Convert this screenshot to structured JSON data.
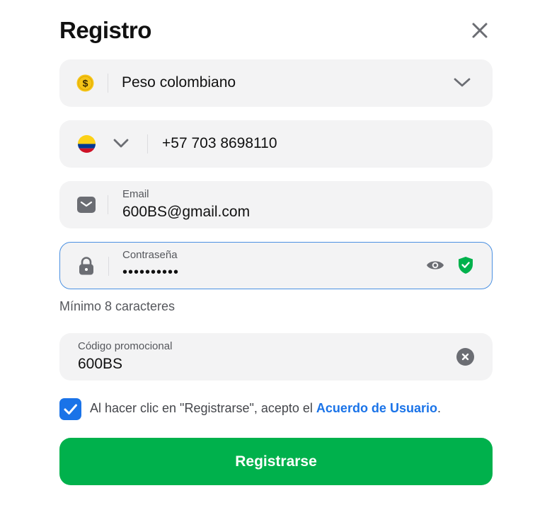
{
  "form": {
    "title": "Registro",
    "currency": {
      "icon": "coin-dollar-icon",
      "label": "Peso colombiano"
    },
    "phone": {
      "country_icon": "colombia-flag-icon",
      "value": "+57 703 8698110"
    },
    "email": {
      "label": "Email",
      "value": "600BS@gmail.com"
    },
    "password": {
      "label": "Contraseña",
      "value": "••••••••••",
      "hint": "Mínimo 8 caracteres",
      "strength": "valid"
    },
    "promo": {
      "label": "Código promocional",
      "value": "600BS"
    },
    "agreement": {
      "checked": true,
      "text": "Al hacer clic en \"Registrarse\", acepto el ",
      "link": "Acuerdo de Usuario",
      "suffix": "."
    },
    "submit_label": "Registrarse"
  },
  "colors": {
    "accent": "#1a73e8",
    "primary_button": "#00b14c",
    "field_bg": "#f3f3f4",
    "focus_border": "#4a90e2"
  }
}
